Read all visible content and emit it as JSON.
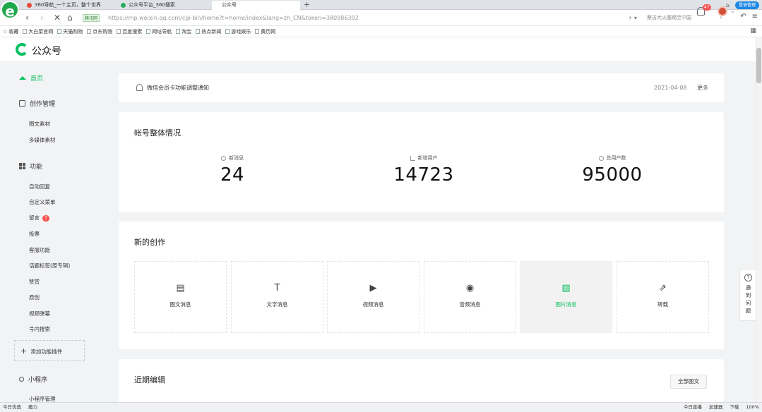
{
  "browser": {
    "tabs": [
      {
        "title": "360导航_一个主页，整个世界"
      },
      {
        "title": "公众号平台_360搜索"
      },
      {
        "title": "公众号"
      }
    ],
    "new_tab": "+",
    "safe_badge": "腾讯网",
    "url": "https://mp.weixin.qq.com/cgi-bin/home?t=home/index&lang=zh_CN&token=380986392",
    "search_placeholder": "蔡吉大火塞踢至中国",
    "login_label": "登录管理",
    "bookmarks": [
      "收藏",
      "大白菜官网",
      "天猫购物",
      "京东购物",
      "百度搜索",
      "网址导航",
      "淘宝",
      "热点新闻",
      "游戏娱乐",
      "黄历网"
    ]
  },
  "header": {
    "logo_text": "公众号",
    "bell_badge": "47"
  },
  "sidebar": {
    "home": "首页",
    "creation": {
      "label": "创作管理",
      "items": [
        "图文素材",
        "多媒体素材"
      ]
    },
    "features": {
      "label": "功能",
      "items": [
        "自动回复",
        "自定义菜单",
        "留言",
        "投票",
        "客服功能",
        "话题标签(原专辑)",
        "赞赏",
        "原创",
        "视频弹幕",
        "号内搜索"
      ],
      "comment_badge": "7"
    },
    "add_plugin": "添加功能插件",
    "mini_program": {
      "label": "小程序",
      "items": [
        "小程序管理"
      ]
    }
  },
  "notice": {
    "text": "微信会员卡功能调整通知",
    "date": "2021-04-08",
    "more": "更多"
  },
  "overview": {
    "title": "帐号整体情况",
    "stats": [
      {
        "label": "新消息",
        "value": "24",
        "icon": "message-icon"
      },
      {
        "label": "新增用户",
        "value": "14723",
        "icon": "bar-chart-icon"
      },
      {
        "label": "总用户数",
        "value": "95000",
        "icon": "user-icon"
      }
    ]
  },
  "create": {
    "title": "新的创作",
    "items": [
      {
        "label": "图文消息",
        "glyph": "▤"
      },
      {
        "label": "文字消息",
        "glyph": "T"
      },
      {
        "label": "视频消息",
        "glyph": "▶"
      },
      {
        "label": "音频消息",
        "glyph": "◉"
      },
      {
        "label": "图片消息",
        "glyph": "▨"
      },
      {
        "label": "转载",
        "glyph": "⇗"
      }
    ]
  },
  "recent": {
    "title": "近期编辑",
    "all_button": "全部图文"
  },
  "help": {
    "text": "遇到问题"
  },
  "statusbar": {
    "left": [
      "今日优选",
      "魔力"
    ],
    "right": [
      "今日直播",
      "加速器",
      "下载",
      "100%"
    ]
  },
  "colors": {
    "accent": "#07c160",
    "badge": "#fa5151"
  }
}
